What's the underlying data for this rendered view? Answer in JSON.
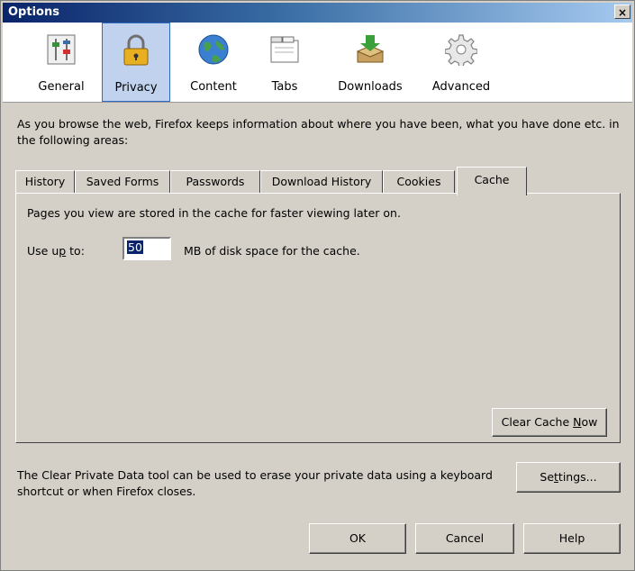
{
  "window": {
    "title": "Options",
    "close_glyph": "×"
  },
  "panes": [
    {
      "label": "General",
      "icon": "sliders-icon"
    },
    {
      "label": "Privacy",
      "icon": "padlock-icon",
      "selected": true
    },
    {
      "label": "Content",
      "icon": "globe-icon"
    },
    {
      "label": "Tabs",
      "icon": "tabs-icon"
    },
    {
      "label": "Downloads",
      "icon": "download-box-icon"
    },
    {
      "label": "Advanced",
      "icon": "gear-icon"
    }
  ],
  "privacy": {
    "description": "As you browse the web, Firefox keeps information about where you have been, what you have done etc. in the following areas:",
    "tabs": [
      "History",
      "Saved Forms",
      "Passwords",
      "Download History",
      "Cookies",
      "Cache"
    ],
    "active_tab": "Cache",
    "cache": {
      "info_text": "Pages you view are stored in the cache for faster viewing later on.",
      "use_up_to_pre": "Use u",
      "use_up_to_accel": "p",
      "use_up_to_post": " to:",
      "size_value": "50",
      "mb_text": "MB of disk space for the cache.",
      "clear_pre": "Clear Cache ",
      "clear_accel": "N",
      "clear_post": "ow"
    },
    "clear_private_text": "The Clear Private Data tool can be used to erase your private data using a keyboard shortcut or when Firefox closes.",
    "settings_pre": "Se",
    "settings_accel": "t",
    "settings_post": "tings..."
  },
  "buttons": {
    "ok": "OK",
    "cancel": "Cancel",
    "help": "Help"
  },
  "colors": {
    "title_bar": "#0a246a",
    "selection": "#0a246a",
    "selected_pane": "#c1d2ee",
    "dialog": "#d4d0c8"
  }
}
